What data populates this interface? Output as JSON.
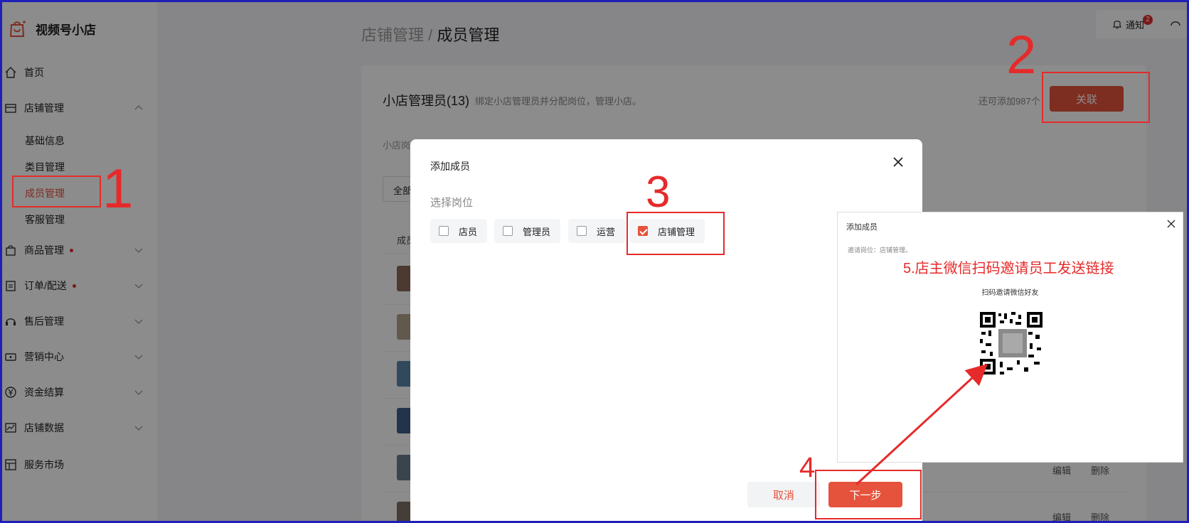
{
  "app": {
    "name": "视频号小店"
  },
  "sidebar": {
    "items": [
      {
        "label": "首页",
        "icon": "home-icon"
      },
      {
        "label": "店铺管理",
        "icon": "shop-icon",
        "expanded": true
      },
      {
        "label": "商品管理",
        "icon": "bag-icon",
        "dot": true
      },
      {
        "label": "订单/配送",
        "icon": "clipboard-icon",
        "dot": true
      },
      {
        "label": "售后管理",
        "icon": "headset-icon"
      },
      {
        "label": "营销中心",
        "icon": "ticket-icon"
      },
      {
        "label": "资金结算",
        "icon": "yuan-icon"
      },
      {
        "label": "店铺数据",
        "icon": "chart-icon"
      },
      {
        "label": "服务市场",
        "icon": "market-icon"
      }
    ],
    "sub_items": [
      {
        "label": "基础信息"
      },
      {
        "label": "类目管理"
      },
      {
        "label": "成员管理",
        "active": true
      },
      {
        "label": "客服管理"
      }
    ]
  },
  "breadcrumb": {
    "parent": "店铺管理",
    "separator": "/",
    "current": "成员管理"
  },
  "header": {
    "notice_label": "通知",
    "notice_count": "2"
  },
  "card": {
    "title": "小店管理员(13)",
    "subtitle": "绑定小店管理员并分配岗位，管理小店。",
    "remain": "还可添加987个",
    "link_button": "关联",
    "position_label": "小店岗",
    "filter_label": "全部",
    "col_member": "成员",
    "row_actions": {
      "edit": "编辑",
      "delete": "删除"
    }
  },
  "dialog": {
    "title": "添加成员",
    "section": "选择岗位",
    "options": [
      {
        "label": "店员",
        "checked": false
      },
      {
        "label": "管理员",
        "checked": false
      },
      {
        "label": "运营",
        "checked": false
      },
      {
        "label": "店铺管理",
        "checked": true
      }
    ],
    "cancel": "取消",
    "next": "下一步"
  },
  "inset": {
    "title": "添加成员",
    "position_info": "邀请岗位：店铺管理。",
    "step_note": "5.店主微信扫码邀请员工发送链接",
    "scan_text": "扫码邀请微信好友"
  },
  "annotations": {
    "n1": "1",
    "n2": "2",
    "n3": "3",
    "n4": "4"
  },
  "colors": {
    "accent": "#e6533c",
    "annotation": "#e62a2a",
    "frame": "#1f1fb8"
  }
}
